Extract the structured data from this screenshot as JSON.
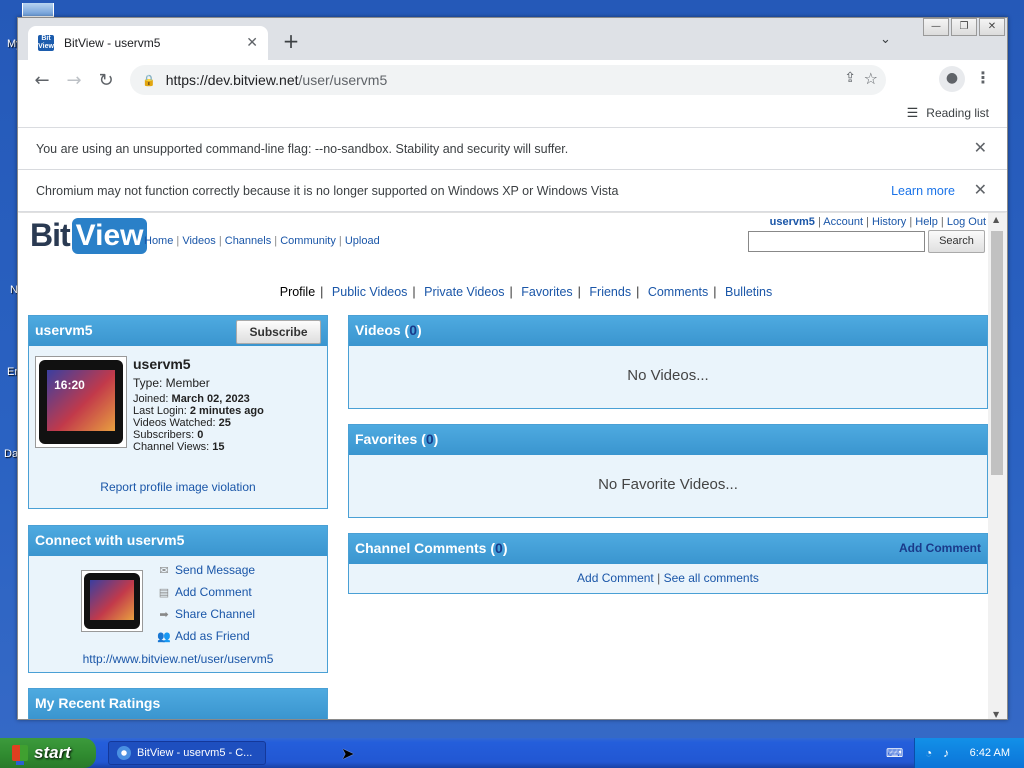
{
  "desktop": {
    "icon_labels": [
      "My",
      "N",
      "Er",
      "Da"
    ]
  },
  "browser": {
    "tab_title": "BitView - uservm5",
    "favicon_text": "Bit View",
    "url_scheme_host": "https://dev.bitview.net",
    "url_path": "/user/uservm5",
    "reading_list_label": "Reading list",
    "infobar_1": "You are using an unsupported command-line flag: --no-sandbox. Stability and security will suffer.",
    "infobar_2": "Chromium may not function correctly because it is no longer supported on Windows XP or Windows Vista",
    "infobar_2_link": "Learn more"
  },
  "site": {
    "logo_bit": "Bit",
    "logo_view": "View",
    "main_nav": [
      "Home",
      "Videos",
      "Channels",
      "Community",
      "Upload"
    ],
    "user_nav": {
      "username": "uservm5",
      "links": [
        "Account",
        "History",
        "Help",
        "Log Out"
      ]
    },
    "search_button": "Search",
    "sub_nav": {
      "current": "Profile",
      "links": [
        "Public Videos",
        "Private Videos",
        "Favorites",
        "Friends",
        "Comments",
        "Bulletins"
      ]
    }
  },
  "profile_box": {
    "title": "uservm5",
    "subscribe": "Subscribe",
    "avatar_time": "16:20",
    "name": "uservm5",
    "type": "Type: Member",
    "joined_label": "Joined: ",
    "joined_value": "March 02, 2023",
    "last_login_label": "Last Login: ",
    "last_login_value": "2 minutes ago",
    "videos_watched_label": "Videos Watched: ",
    "videos_watched_value": "25",
    "subscribers_label": "Subscribers: ",
    "subscribers_value": "0",
    "channel_views_label": "Channel Views: ",
    "channel_views_value": "15",
    "report_link": "Report profile image violation"
  },
  "connect_box": {
    "title": "Connect with uservm5",
    "links": [
      "Send Message",
      "Add Comment",
      "Share Channel",
      "Add as Friend"
    ],
    "channel_url": "http://www.bitview.net/user/uservm5"
  },
  "ratings_box": {
    "title": "My Recent Ratings"
  },
  "videos_box": {
    "title": "Videos",
    "count": "0",
    "empty": "No Videos..."
  },
  "favorites_box": {
    "title": "Favorites",
    "count": "0",
    "empty": "No Favorite Videos..."
  },
  "comments_box": {
    "title": "Channel Comments",
    "count": "0",
    "add_comment_header": "Add Comment",
    "add_comment": "Add Comment",
    "see_all": "See all comments"
  },
  "taskbar": {
    "start": "start",
    "task": "BitView - uservm5 - C...",
    "clock": "6:42 AM"
  }
}
